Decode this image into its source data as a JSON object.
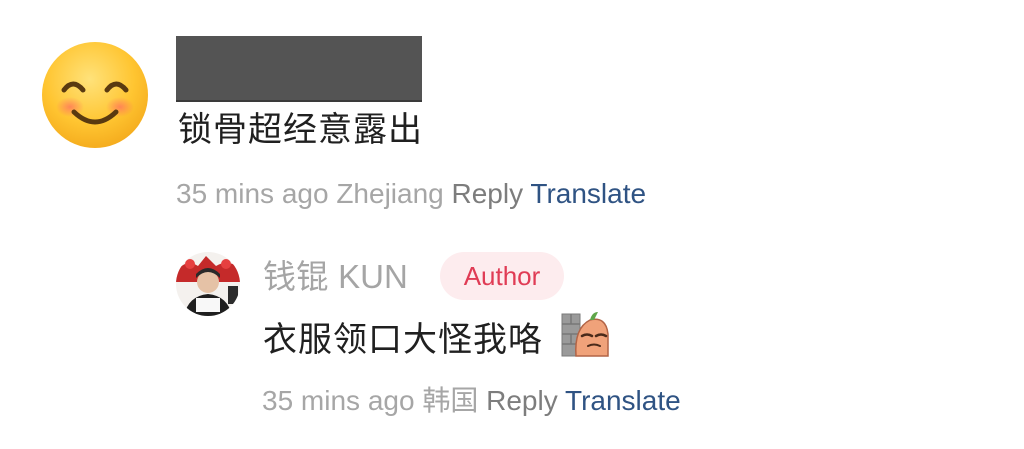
{
  "comment": {
    "avatar_icon": "smiling-face-icon",
    "username_redacted": true,
    "text": "锁骨超经意露出",
    "meta": {
      "time": "35 mins ago",
      "location": "Zhejiang",
      "reply_label": "Reply",
      "translate_label": "Translate"
    }
  },
  "reply": {
    "author_name": "钱锟 KUN",
    "badge_label": "Author",
    "text": "衣服领口大怪我咯",
    "sticker_icon": "peeking-sticker-icon",
    "meta": {
      "time": "35 mins ago",
      "location": "韩国",
      "reply_label": "Reply",
      "translate_label": "Translate"
    }
  },
  "colors": {
    "meta_gray": "#a6a6a6",
    "reply_gray": "#7d7d7d",
    "translate_blue": "#2f5383",
    "badge_bg": "#fdecee",
    "badge_text": "#e03c55"
  }
}
